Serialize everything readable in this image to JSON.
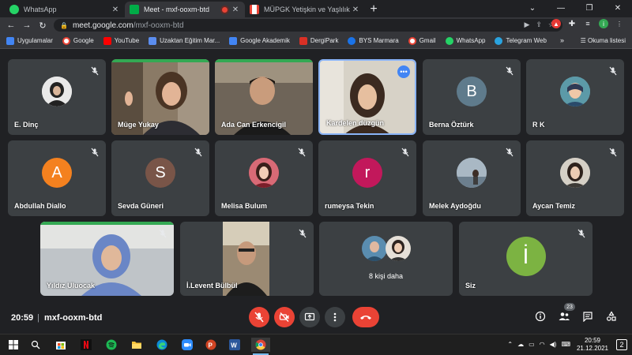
{
  "browser": {
    "tabs": [
      {
        "title": "WhatsApp",
        "active": false,
        "favicon_color": "#25d366"
      },
      {
        "title": "Meet - mxf-ooxm-btd",
        "active": true,
        "favicon_color": "#00ac47"
      },
      {
        "title": "MÜPGK Yetişkin ve Yaşlılık Psikoloji",
        "active": false,
        "favicon_color": "#ea4335"
      }
    ],
    "url_host": "meet.google.com",
    "url_path": "/mxf-ooxm-btd",
    "profile_initial": "i"
  },
  "bookmarks": [
    {
      "label": "Uygulamalar",
      "color": "#4285f4"
    },
    {
      "label": "Google",
      "color": "#ea4335"
    },
    {
      "label": "YouTube",
      "color": "#ff0000"
    },
    {
      "label": "Uzaktan Eğitim Mar...",
      "color": "#5b8def"
    },
    {
      "label": "Google Akademik",
      "color": "#4285f4"
    },
    {
      "label": "DergiPark",
      "color": "#d93025"
    },
    {
      "label": "BYS Marmara",
      "color": "#1a73e8"
    },
    {
      "label": "Gmail",
      "color": "#ea4335"
    },
    {
      "label": "WhatsApp",
      "color": "#25d366"
    },
    {
      "label": "Telegram Web",
      "color": "#2aa3df"
    }
  ],
  "bookmarks_more": "»",
  "reading_list": "Okuma listesi",
  "participants": [
    {
      "name": "E. Dinç",
      "kind": "photo",
      "color": "#6b6b6b"
    },
    {
      "name": "Müge Yukay",
      "kind": "video",
      "color": "#c9a27a"
    },
    {
      "name": "Ada Can Erkencigil",
      "kind": "video",
      "color": "#8a7763"
    },
    {
      "name": "Kardelen düzgün",
      "kind": "video",
      "color": "#d8d3c8"
    },
    {
      "name": "Berna Öztürk",
      "kind": "letter",
      "letter": "B",
      "color": "#5f7b8c"
    },
    {
      "name": "R K",
      "kind": "photo",
      "color": "#6aa7b3"
    },
    {
      "name": "Abdullah Diallo",
      "kind": "letter",
      "letter": "A",
      "color": "#f4811f"
    },
    {
      "name": "Sevda Güneri",
      "kind": "letter",
      "letter": "S",
      "color": "#795548"
    },
    {
      "name": "Melisa Bulum",
      "kind": "photo",
      "color": "#b03a48"
    },
    {
      "name": "rumeysa Tekin",
      "kind": "letter",
      "letter": "r",
      "color": "#c2185b"
    },
    {
      "name": "Melek Aydoğdu",
      "kind": "photo",
      "color": "#8fa3b5"
    },
    {
      "name": "Aycan Temiz",
      "kind": "photo",
      "color": "#b9b3a8"
    },
    {
      "name": "Yıldız Uluocak",
      "kind": "video",
      "color": "#7c8fb8"
    },
    {
      "name": "İ.Levent Bülbül",
      "kind": "video",
      "color": "#6a5f55"
    },
    {
      "name": "8 kişi daha",
      "kind": "more"
    },
    {
      "name": "Siz",
      "kind": "letter",
      "letter": "İ",
      "color": "#7cb342"
    }
  ],
  "meeting": {
    "time": "20:59",
    "separator": "|",
    "code": "mxf-ooxm-btd",
    "participant_count": "23"
  },
  "taskbar": {
    "time": "20:59",
    "date": "21.12.2021",
    "notif_count": "2"
  }
}
